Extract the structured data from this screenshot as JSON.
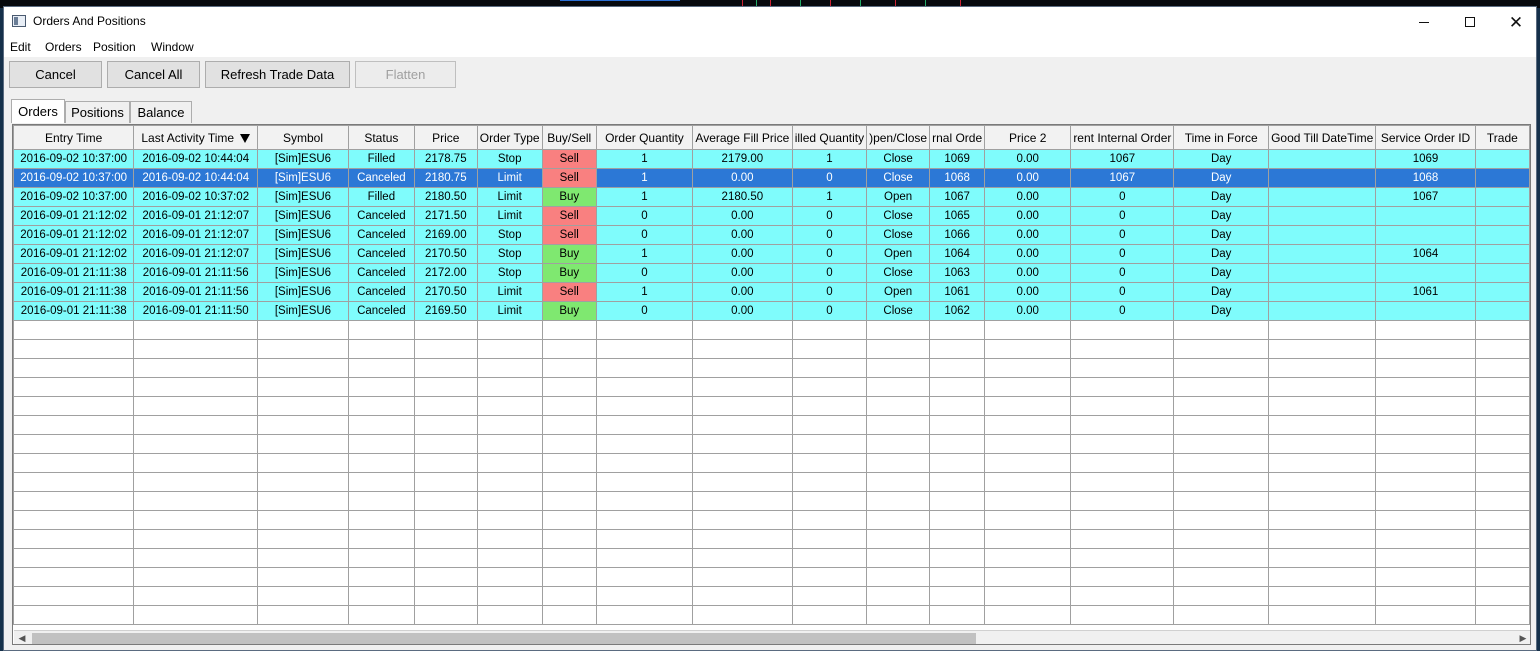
{
  "window": {
    "title": "Orders And Positions"
  },
  "menu": [
    "Edit",
    "Orders",
    "Position",
    "Window"
  ],
  "toolbar": {
    "cancel": "Cancel",
    "cancel_all": "Cancel All",
    "refresh": "Refresh Trade Data",
    "flatten": "Flatten"
  },
  "tabs": [
    "Orders",
    "Positions",
    "Balance"
  ],
  "columns": [
    "Entry Time",
    "Last Activity Time",
    "Symbol",
    "Status",
    "Price",
    "Order Type",
    "Buy/Sell",
    "Order Quantity",
    "Average Fill Price",
    "illed Quantity",
    ")pen/Close",
    "rnal Orde",
    "Price 2",
    "rent Internal Order",
    "Time in Force",
    "Good Till DateTime",
    "Service Order ID",
    "Trade"
  ],
  "rows": [
    [
      "2016-09-02  10:37:00",
      "2016-09-02  10:44:04",
      "[Sim]ESU6",
      "Filled",
      "2178.75",
      "Stop",
      "Sell",
      "1",
      "2179.00",
      "1",
      "Close",
      "1069",
      "0.00",
      "1067",
      "Day",
      "",
      "1069",
      ""
    ],
    [
      "2016-09-02  10:37:00",
      "2016-09-02  10:44:04",
      "[Sim]ESU6",
      "Canceled",
      "2180.75",
      "Limit",
      "Sell",
      "1",
      "0.00",
      "0",
      "Close",
      "1068",
      "0.00",
      "1067",
      "Day",
      "",
      "1068",
      ""
    ],
    [
      "2016-09-02  10:37:00",
      "2016-09-02  10:37:02",
      "[Sim]ESU6",
      "Filled",
      "2180.50",
      "Limit",
      "Buy",
      "1",
      "2180.50",
      "1",
      "Open",
      "1067",
      "0.00",
      "0",
      "Day",
      "",
      "1067",
      ""
    ],
    [
      "2016-09-01  21:12:02",
      "2016-09-01  21:12:07",
      "[Sim]ESU6",
      "Canceled",
      "2171.50",
      "Limit",
      "Sell",
      "0",
      "0.00",
      "0",
      "Close",
      "1065",
      "0.00",
      "0",
      "Day",
      "",
      "",
      ""
    ],
    [
      "2016-09-01  21:12:02",
      "2016-09-01  21:12:07",
      "[Sim]ESU6",
      "Canceled",
      "2169.00",
      "Stop",
      "Sell",
      "0",
      "0.00",
      "0",
      "Close",
      "1066",
      "0.00",
      "0",
      "Day",
      "",
      "",
      ""
    ],
    [
      "2016-09-01  21:12:02",
      "2016-09-01  21:12:07",
      "[Sim]ESU6",
      "Canceled",
      "2170.50",
      "Stop",
      "Buy",
      "1",
      "0.00",
      "0",
      "Open",
      "1064",
      "0.00",
      "0",
      "Day",
      "",
      "1064",
      ""
    ],
    [
      "2016-09-01  21:11:38",
      "2016-09-01  21:11:56",
      "[Sim]ESU6",
      "Canceled",
      "2172.00",
      "Stop",
      "Buy",
      "0",
      "0.00",
      "0",
      "Close",
      "1063",
      "0.00",
      "0",
      "Day",
      "",
      "",
      ""
    ],
    [
      "2016-09-01  21:11:38",
      "2016-09-01  21:11:56",
      "[Sim]ESU6",
      "Canceled",
      "2170.50",
      "Limit",
      "Sell",
      "1",
      "0.00",
      "0",
      "Open",
      "1061",
      "0.00",
      "0",
      "Day",
      "",
      "1061",
      ""
    ],
    [
      "2016-09-01  21:11:38",
      "2016-09-01  21:11:50",
      "[Sim]ESU6",
      "Canceled",
      "2169.50",
      "Limit",
      "Buy",
      "0",
      "0.00",
      "0",
      "Close",
      "1062",
      "0.00",
      "0",
      "Day",
      "",
      "",
      ""
    ]
  ],
  "selected_row": 1,
  "colors": {
    "row_bg": "#7ffcfc",
    "selected_bg": "#2c78d6",
    "sell_bg": "#f98080",
    "buy_bg": "#7fe870"
  }
}
